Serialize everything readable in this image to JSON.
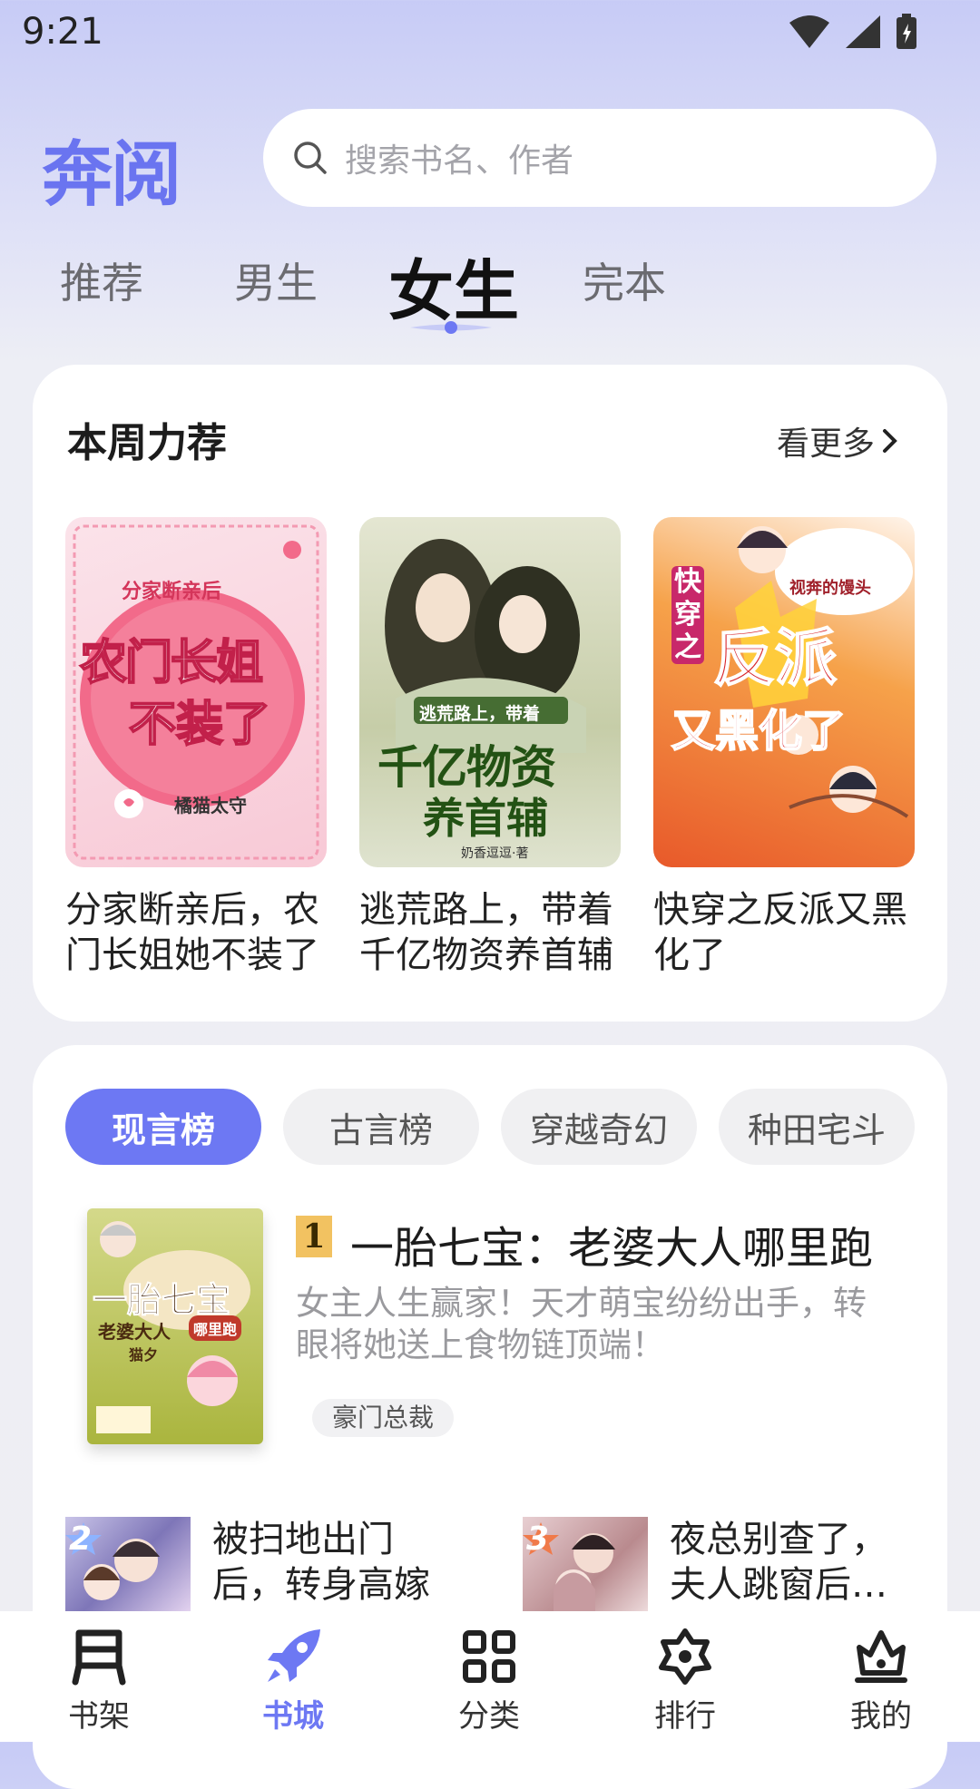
{
  "status_bar": {
    "time": "9:21"
  },
  "header": {
    "logo": "奔阅",
    "search_placeholder": "搜索书名、作者"
  },
  "tabs": [
    {
      "label": "推荐",
      "active": false
    },
    {
      "label": "男生",
      "active": false
    },
    {
      "label": "女生",
      "active": true
    },
    {
      "label": "完本",
      "active": false
    }
  ],
  "weekly": {
    "title": "本周力荐",
    "more": "看更多",
    "books": [
      {
        "title": "分家断亲后，农门长姐她不装了",
        "cover_texts": [
          "分家断亲后",
          "农门长姐",
          "不装了",
          "橘猫太守"
        ]
      },
      {
        "title": "逃荒路上，带着千亿物资养首辅",
        "cover_texts": [
          "逃荒路上，带着",
          "千亿物资",
          "养首辅",
          "奶香逗逗·著"
        ]
      },
      {
        "title": "快穿之反派又黑化了",
        "cover_texts": [
          "快穿之",
          "反派",
          "又黑化了",
          "视奔的馒头"
        ]
      }
    ]
  },
  "ranking": {
    "chips": [
      {
        "label": "现言榜",
        "active": true
      },
      {
        "label": "古言榜",
        "active": false
      },
      {
        "label": "穿越奇幻",
        "active": false
      },
      {
        "label": "种田宅斗",
        "active": false
      }
    ],
    "top1": {
      "rank": "1",
      "title": "一胎七宝：老婆大人哪里跑",
      "desc": "女主人生赢家！天才萌宝纷纷出手，转眼将她送上食物链顶端！",
      "tag": "豪门总裁",
      "cover_texts": [
        "一胎七宝",
        "老婆大人",
        "哪里跑",
        "猫夕"
      ]
    },
    "others": [
      {
        "rank": "2",
        "title": "被扫地出门后，转身高嫁"
      },
      {
        "rank": "3",
        "title": "夜总别查了，夫人跳窗后跑了"
      }
    ]
  },
  "bottom_nav": [
    {
      "label": "书架",
      "icon": "bookshelf-icon",
      "active": false
    },
    {
      "label": "书城",
      "icon": "rocket-icon",
      "active": true
    },
    {
      "label": "分类",
      "icon": "grid-icon",
      "active": false
    },
    {
      "label": "排行",
      "icon": "rank-star-icon",
      "active": false
    },
    {
      "label": "我的",
      "icon": "profile-icon",
      "active": false
    }
  ],
  "colors": {
    "accent": "#6d78f3",
    "logo": "#6a74f0",
    "rank_gold": "#f2c261"
  }
}
